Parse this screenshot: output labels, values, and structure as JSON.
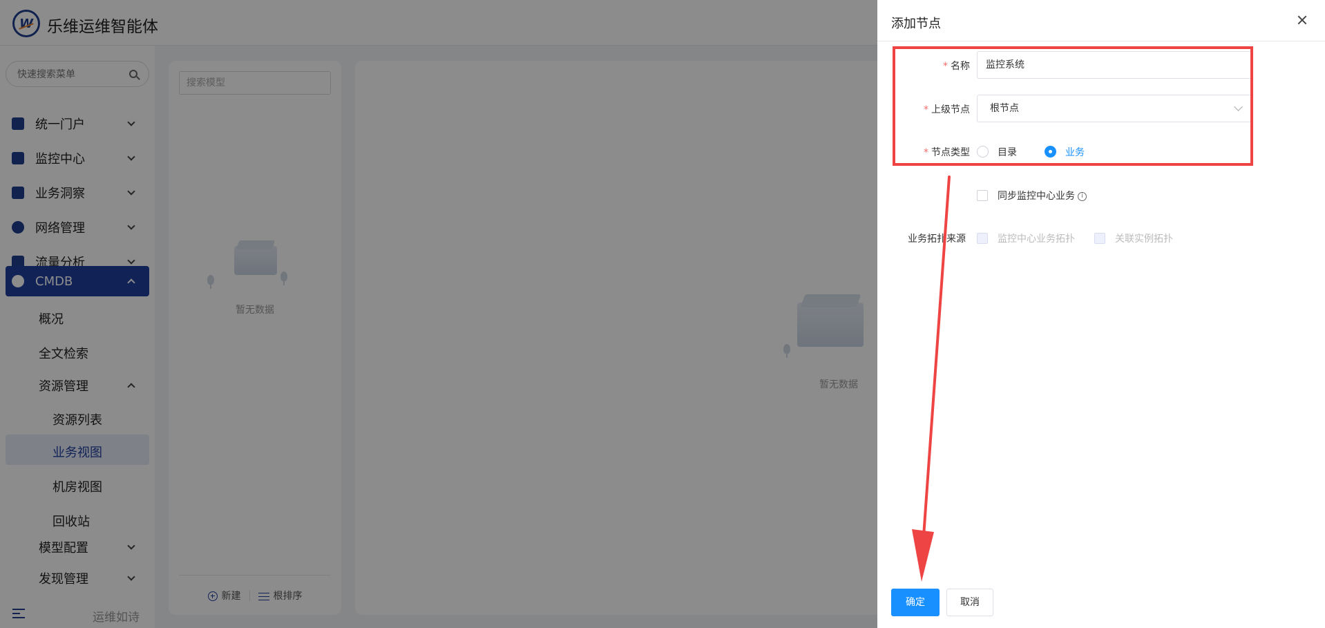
{
  "app": {
    "brand": "乐维运维智能体",
    "logo_letter": "W"
  },
  "sidebar": {
    "search_placeholder": "快速搜索菜单",
    "items": [
      {
        "label": "统一门户",
        "icon": "portal-icon"
      },
      {
        "label": "监控中心",
        "icon": "monitor-icon"
      },
      {
        "label": "业务洞察",
        "icon": "insight-icon"
      },
      {
        "label": "网络管理",
        "icon": "globe-icon"
      },
      {
        "label": "流量分析",
        "icon": "chart-icon"
      },
      {
        "label": "CMDB",
        "icon": "cube-icon"
      }
    ],
    "cmdb_sub": {
      "overview": "概况",
      "fulltext": "全文检索",
      "resource_mgmt": "资源管理",
      "resource_list": "资源列表",
      "business_view": "业务视图",
      "room_view": "机房视图",
      "recycle": "回收站",
      "model_config": "模型配置",
      "discovery_mgmt": "发现管理"
    },
    "footer_slogan": "运维如诗"
  },
  "left_panel": {
    "search_placeholder": "搜索模型",
    "empty_text": "暂无数据",
    "new_label": "新建",
    "sort_label": "根排序"
  },
  "main_panel": {
    "empty_text": "暂无数据"
  },
  "drawer": {
    "title": "添加节点",
    "fields": {
      "name_label": "名称",
      "name_value": "监控系统",
      "parent_label": "上级节点",
      "parent_value": "根节点",
      "type_label": "节点类型",
      "type_options": [
        "目录",
        "业务"
      ],
      "type_selected": "业务",
      "sync_label": "同步监控中心业务",
      "topo_source_label": "业务拓扑来源",
      "topo_options": [
        "监控中心业务拓扑",
        "关联实例拓扑"
      ]
    },
    "confirm_label": "确定",
    "cancel_label": "取消"
  },
  "colors": {
    "primary": "#1890ff",
    "brand_navy": "#1f3f9e",
    "required": "#f56c6c",
    "annotation_red": "#ee4444"
  }
}
